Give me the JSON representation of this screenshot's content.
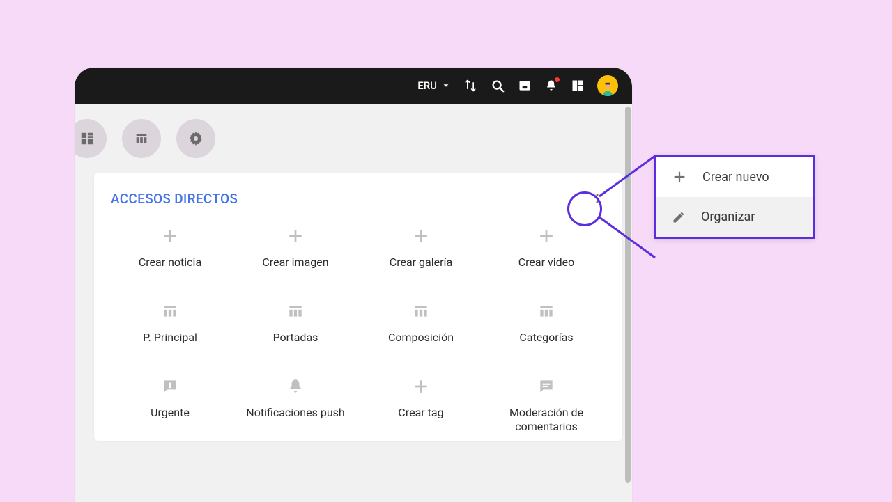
{
  "topbar": {
    "workspace_label": "ERU"
  },
  "card": {
    "title": "ACCESOS DIRECTOS"
  },
  "shortcuts": [
    {
      "label": "Crear noticia",
      "icon": "plus"
    },
    {
      "label": "Crear imagen",
      "icon": "plus"
    },
    {
      "label": "Crear galería",
      "icon": "plus"
    },
    {
      "label": "Crear video",
      "icon": "plus"
    },
    {
      "label": "P. Principal",
      "icon": "table"
    },
    {
      "label": "Portadas",
      "icon": "table"
    },
    {
      "label": "Composición",
      "icon": "table"
    },
    {
      "label": "Categorías",
      "icon": "table"
    },
    {
      "label": "Urgente",
      "icon": "alert-chat"
    },
    {
      "label": "Notificaciones push",
      "icon": "bell"
    },
    {
      "label": "Crear tag",
      "icon": "plus"
    },
    {
      "label": "Moderación de comentarios",
      "icon": "chat"
    }
  ],
  "popover": {
    "items": [
      {
        "label": "Crear nuevo",
        "icon": "plus"
      },
      {
        "label": "Organizar",
        "icon": "pencil"
      }
    ]
  }
}
